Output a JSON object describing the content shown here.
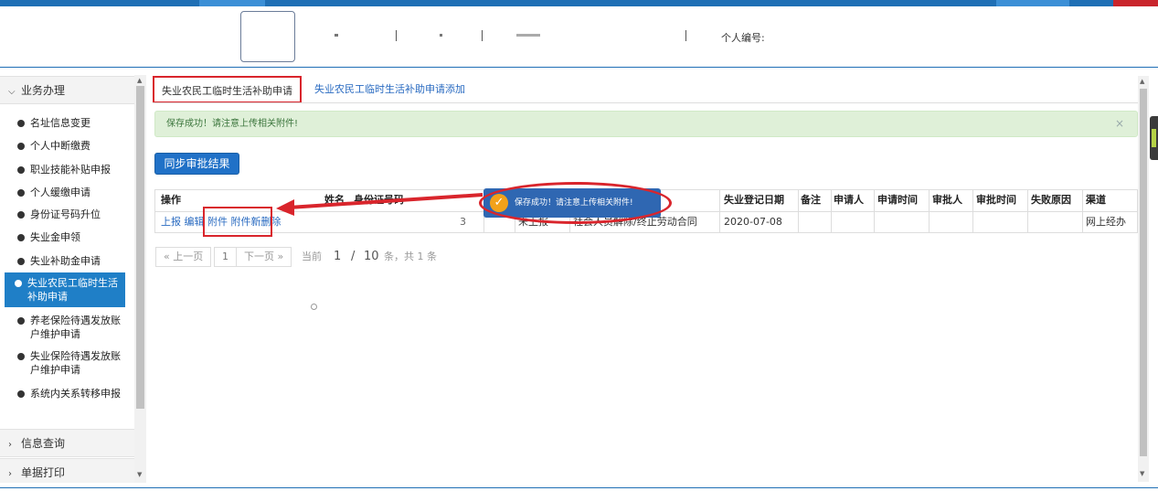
{
  "header": {
    "personal_id_label": "个人编号:"
  },
  "sidebar": {
    "section_business": "业务办理",
    "section_query": "信息查询",
    "section_print": "单据打印",
    "items": [
      {
        "label": "名址信息变更"
      },
      {
        "label": "个人中断缴费"
      },
      {
        "label": "职业技能补贴申报"
      },
      {
        "label": "个人缓缴申请"
      },
      {
        "label": "身份证号码升位"
      },
      {
        "label": "失业金申领"
      },
      {
        "label": "失业补助金申请"
      },
      {
        "label": "失业农民工临时生活补助申请"
      },
      {
        "label": "养老保险待遇发放账户维护申请"
      },
      {
        "label": "失业保险待遇发放账户维护申请"
      },
      {
        "label": "系统内关系转移申报"
      }
    ]
  },
  "tabs": {
    "active": "失业农民工临时生活补助申请",
    "add": "失业农民工临时生活补助申请添加"
  },
  "alert": {
    "message": "保存成功！请注意上传相关附件!",
    "close": "×"
  },
  "sync_button": "同步审批结果",
  "table": {
    "headers": {
      "op": "操作",
      "name": "姓名",
      "id_number": "身份证号码",
      "reg_date": "失业登记日期",
      "note": "备注",
      "applicant": "申请人",
      "apply_time": "申请时间",
      "approver": "审批人",
      "approve_time": "审批时间",
      "fail_reason": "失败原因",
      "channel": "渠道"
    },
    "row": {
      "actions": {
        "report": "上报",
        "edit": "编辑",
        "attach": "附件",
        "attach_new": "附件新",
        "delete": "删除"
      },
      "id_suffix": "3",
      "status": "未上报",
      "reason": "社会人员解除/终止劳动合同",
      "reg_date": "2020-07-08",
      "channel": "网上经办"
    }
  },
  "pager": {
    "prev": "« 上一页",
    "page": "1",
    "next": "下一页 »",
    "current_label": "当前",
    "current": "1",
    "slash": "/",
    "page_size": "10",
    "total_text": "条，共 1 条"
  },
  "toast": {
    "message": "保存成功！请注意上传相关附件!",
    "icon": "check-icon"
  },
  "colors": {
    "accent": "#1f6fb5",
    "annotation": "#d9252c",
    "success_bg": "#dff0d8",
    "active_item": "#1f7fc7"
  }
}
